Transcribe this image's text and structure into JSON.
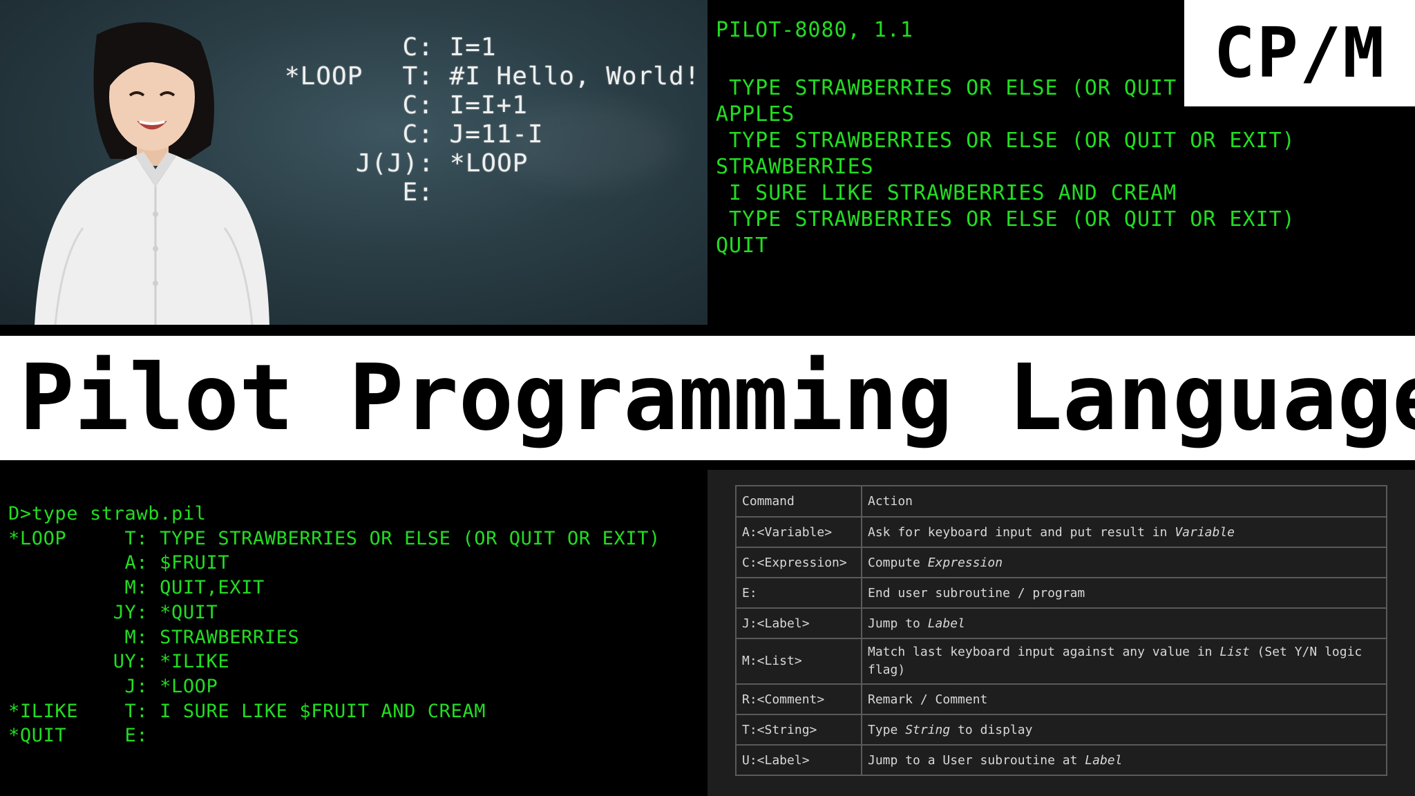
{
  "photo_panel": {
    "code_lines": [
      {
        "label": "",
        "cmd": "C: I=1"
      },
      {
        "label": "*LOOP",
        "cmd": "T: #I Hello, World!"
      },
      {
        "label": "",
        "cmd": "C: I=I+1"
      },
      {
        "label": "",
        "cmd": "C: J=11-I"
      },
      {
        "label": "",
        "cmd": "J(J): *LOOP"
      },
      {
        "label": "",
        "cmd": "E:"
      }
    ]
  },
  "top_terminal": {
    "lines": [
      "PILOT-8080, 1.1",
      " TYPE STRAWBERRIES OR ELSE (OR QUIT",
      "APPLES",
      " TYPE STRAWBERRIES OR ELSE (OR QUIT OR EXIT)",
      "STRAWBERRIES",
      " I SURE LIKE STRAWBERRIES AND CREAM",
      " TYPE STRAWBERRIES OR ELSE (OR QUIT OR EXIT)",
      "QUIT"
    ],
    "badge": "CP/M"
  },
  "banner": {
    "title": "Pilot Programming Language"
  },
  "bottom_terminal": {
    "lines": [
      "D>type strawb.pil",
      "*LOOP     T: TYPE STRAWBERRIES OR ELSE (OR QUIT OR EXIT)",
      "          A: $FRUIT",
      "          M: QUIT,EXIT",
      "         JY: *QUIT",
      "          M: STRAWBERRIES",
      "         UY: *ILIKE",
      "          J: *LOOP",
      "*ILIKE    T: I SURE LIKE $FRUIT AND CREAM",
      "*QUIT     E:"
    ]
  },
  "command_table": {
    "headers": [
      "Command",
      "Action"
    ],
    "rows": [
      {
        "cmd": "A:<Variable>",
        "pre": "Ask for keyboard input and put result in ",
        "em": "Variable",
        "post": ""
      },
      {
        "cmd": "C:<Expression>",
        "pre": "Compute ",
        "em": "Expression",
        "post": ""
      },
      {
        "cmd": "E:",
        "pre": "End user subroutine / program",
        "em": "",
        "post": ""
      },
      {
        "cmd": "J:<Label>",
        "pre": "Jump to ",
        "em": "Label",
        "post": ""
      },
      {
        "cmd": "M:<List>",
        "pre": "Match last keyboard input against any value in ",
        "em": "List",
        "post": " (Set Y/N logic flag)"
      },
      {
        "cmd": "R:<Comment>",
        "pre": "Remark / Comment",
        "em": "",
        "post": ""
      },
      {
        "cmd": "T:<String>",
        "pre": "Type ",
        "em": "String",
        "post": " to display"
      },
      {
        "cmd": "U:<Label>",
        "pre": "Jump to a User subroutine at ",
        "em": "Label",
        "post": ""
      }
    ]
  },
  "colors": {
    "terminal_green": "#22dd22",
    "chalkboard": "#2a3d45",
    "table_bg": "#1e1e1e",
    "table_border": "#5a5a5a"
  }
}
